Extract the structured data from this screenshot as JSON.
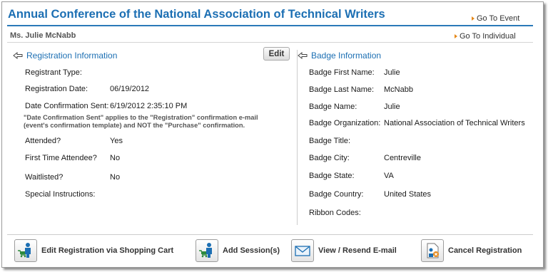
{
  "header": {
    "title": "Annual Conference of the National Association of Technical Writers",
    "go_to_event": "Go To Event",
    "person_name": "Ms. Julie McNabb",
    "go_to_individual": "Go To Individual"
  },
  "registration": {
    "heading": "Registration Information",
    "edit_label": "Edit",
    "fields": {
      "registrant_type": {
        "label": "Registrant Type:",
        "value": ""
      },
      "registration_date": {
        "label": "Registration Date:",
        "value": "06/19/2012"
      },
      "date_confirmation_sent": {
        "label": "Date Confirmation Sent:",
        "value": "6/19/2012 2:35:10 PM"
      },
      "attended": {
        "label": "Attended?",
        "value": "Yes"
      },
      "first_time_attendee": {
        "label": "First Time Attendee?",
        "value": "No"
      },
      "waitlisted": {
        "label": "Waitlisted?",
        "value": "No"
      },
      "special_instructions": {
        "label": "Special Instructions:",
        "value": ""
      }
    },
    "note_line1": "\"Date Confirmation Sent\" applies to the \"Registration\" confirmation e-mail",
    "note_line2": "(event's confirmation template) and NOT the \"Purchase\" confirmation."
  },
  "badge": {
    "heading": "Badge Information",
    "fields": {
      "first_name": {
        "label": "Badge First Name:",
        "value": "Julie"
      },
      "last_name": {
        "label": "Badge Last Name:",
        "value": "McNabb"
      },
      "name": {
        "label": "Badge Name:",
        "value": "Julie"
      },
      "organization": {
        "label": "Badge Organization:",
        "value": "National Association of Technical Writers"
      },
      "title": {
        "label": "Badge Title:",
        "value": ""
      },
      "city": {
        "label": "Badge City:",
        "value": "Centreville"
      },
      "state": {
        "label": "Badge State:",
        "value": "VA"
      },
      "country": {
        "label": "Badge Country:",
        "value": "United States"
      },
      "ribbon_codes": {
        "label": "Ribbon Codes:",
        "value": ""
      }
    }
  },
  "actions": {
    "edit_registration": "Edit Registration via Shopping Cart",
    "add_sessions": "Add Session(s)",
    "view_resend_email": "View / Resend E-mail",
    "cancel_registration": "Cancel Registration"
  },
  "icons": {
    "nav_arrow": "orange-triangle-icon",
    "section_arrow": "collapse-arrow-icon",
    "edit_registration": "cart-person-icon",
    "add_sessions": "cart-person-icon",
    "view_resend_email": "envelope-icon",
    "cancel_registration": "cancel-document-icon"
  },
  "colors": {
    "title_blue": "#1c6fb3",
    "accent_orange": "#e6891a",
    "rule_blue": "#2a79b8"
  }
}
